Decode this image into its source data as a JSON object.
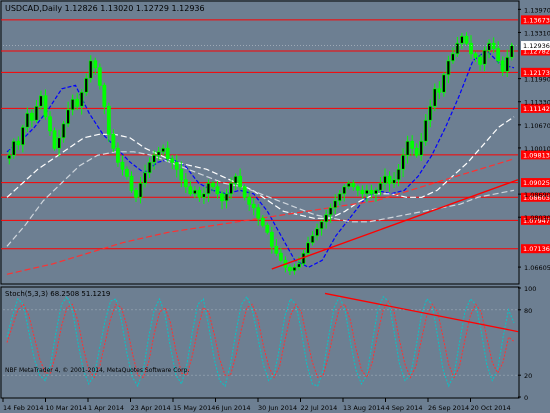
{
  "colors": {
    "background": "#6d7f92",
    "panel_border": "#000000",
    "axis_text": "#000000",
    "candle": "#00ff00",
    "resistance": "#ff0000",
    "ma_fast": "#0000ff",
    "ma_mid": "#ffffff",
    "ma_slow_dash": "#ff3030",
    "ma_gray_dash": "#cfd6dd",
    "stoch_main": "#00c8c8",
    "stoch_signal": "#ff3030",
    "price_label_bg": "#ff0000",
    "price_label_text": "#ffffff",
    "current_label_bg": "#ffffff",
    "current_label_text": "#000000"
  },
  "chart_data": [
    {
      "type": "candlestick",
      "header": "USDCAD,Daily  1.12826 1.13020 1.12729 1.12936",
      "symbol": "USDCAD",
      "timeframe": "Daily",
      "ohlc_current": {
        "open": 1.12826,
        "high": 1.1302,
        "low": 1.12729,
        "close": 1.12936
      },
      "y_ticks": [
        "1.13970",
        "1.13310",
        "1.11990",
        "1.11330",
        "1.10670",
        "1.10010",
        "1.08690",
        "1.08030",
        "1.06605"
      ],
      "ylim": [
        1.0615,
        1.1418
      ],
      "x_ticks": [
        "14 Feb 2014",
        "10 Mar 2014",
        "1 Apr 2014",
        "23 Apr 2014",
        "15 May 2014",
        "6 Jun 2014",
        "30 Jun 2014",
        "22 Jul 2014",
        "13 Aug 2014",
        "4 Sep 2014",
        "26 Sep 2014",
        "20 Oct 2014"
      ],
      "horizontal_lines": [
        {
          "price": 1.1367,
          "label": "1.13673"
        },
        {
          "price": 1.1278,
          "label": "1.12782"
        },
        {
          "price": 1.1217,
          "label": "1.12173"
        },
        {
          "price": 1.1114,
          "label": "1.11142"
        },
        {
          "price": 1.0981,
          "label": "1.09813"
        },
        {
          "price": 1.0902,
          "label": "1.09025"
        },
        {
          "price": 1.086,
          "label": "1.08603"
        },
        {
          "price": 1.0794,
          "label": "1.07947"
        },
        {
          "price": 1.0713,
          "label": "1.07136"
        }
      ],
      "current_price_label": "1.12936",
      "current_price": 1.12936,
      "close_series": [
        1.098,
        1.102,
        1.101,
        1.106,
        1.11,
        1.108,
        1.112,
        1.115,
        1.109,
        1.105,
        1.1,
        1.103,
        1.107,
        1.111,
        1.114,
        1.112,
        1.116,
        1.12,
        1.125,
        1.123,
        1.118,
        1.112,
        1.104,
        1.1,
        1.096,
        1.094,
        1.092,
        1.088,
        1.086,
        1.09,
        1.093,
        1.096,
        1.098,
        1.099,
        1.1,
        1.097,
        1.096,
        1.094,
        1.091,
        1.089,
        1.087,
        1.088,
        1.086,
        1.087,
        1.09,
        1.089,
        1.087,
        1.085,
        1.087,
        1.09,
        1.092,
        1.089,
        1.086,
        1.084,
        1.083,
        1.08,
        1.078,
        1.076,
        1.072,
        1.07,
        1.068,
        1.066,
        1.065,
        1.066,
        1.067,
        1.07,
        1.073,
        1.075,
        1.077,
        1.079,
        1.081,
        1.083,
        1.085,
        1.087,
        1.089,
        1.09,
        1.089,
        1.088,
        1.087,
        1.088,
        1.087,
        1.088,
        1.09,
        1.092,
        1.09,
        1.091,
        1.094,
        1.098,
        1.102,
        1.1,
        1.098,
        1.102,
        1.108,
        1.112,
        1.117,
        1.116,
        1.121,
        1.125,
        1.127,
        1.13,
        1.132,
        1.13,
        1.127,
        1.126,
        1.124,
        1.128,
        1.13,
        1.1285,
        1.125,
        1.122,
        1.126,
        1.12936
      ],
      "overlays": [
        {
          "name": "ma-fast",
          "style": "dashed",
          "color_key": "ma_fast",
          "values": [
            1.099,
            1.102,
            1.106,
            1.111,
            1.117,
            1.118,
            1.11,
            1.104,
            1.1,
            1.096,
            1.093,
            1.096,
            1.097,
            1.095,
            1.09,
            1.088,
            1.087,
            1.088,
            1.087,
            1.082,
            1.075,
            1.068,
            1.066,
            1.068,
            1.075,
            1.08,
            1.085,
            1.088,
            1.087,
            1.088,
            1.092,
            1.098,
            1.106,
            1.115,
            1.125,
            1.128,
            1.124,
            1.123
          ]
        },
        {
          "name": "ma-mid",
          "style": "dashed",
          "color_key": "ma_mid",
          "values": [
            1.086,
            1.09,
            1.094,
            1.097,
            1.1,
            1.103,
            1.104,
            1.104,
            1.103,
            1.1,
            1.098,
            1.096,
            1.095,
            1.094,
            1.092,
            1.09,
            1.088,
            1.085,
            1.082,
            1.081,
            1.08,
            1.08,
            1.082,
            1.085,
            1.087,
            1.087,
            1.086,
            1.086,
            1.088,
            1.092,
            1.096,
            1.101,
            1.106,
            1.109
          ]
        },
        {
          "name": "ma-gray",
          "style": "dashed",
          "color_key": "ma_gray_dash",
          "values": [
            1.072,
            1.078,
            1.085,
            1.09,
            1.095,
            1.098,
            1.099,
            1.099,
            1.098,
            1.096,
            1.094,
            1.092,
            1.09,
            1.089,
            1.087,
            1.085,
            1.083,
            1.081,
            1.08,
            1.079,
            1.079,
            1.08,
            1.081,
            1.082,
            1.083,
            1.084,
            1.086,
            1.087,
            1.088
          ]
        },
        {
          "name": "ma-slow",
          "style": "dashed",
          "color_key": "ma_slow_dash",
          "values": [
            1.064,
            1.0655,
            1.067,
            1.069,
            1.071,
            1.073,
            1.0745,
            1.076,
            1.077,
            1.078,
            1.079,
            1.08,
            1.081,
            1.082,
            1.083,
            1.084,
            1.085,
            1.087,
            1.089,
            1.091,
            1.093,
            1.095,
            1.097
          ]
        }
      ],
      "trendlines": [
        {
          "name": "support-trendline",
          "from_index": 58,
          "from_price": 1.0655,
          "to_index": 113,
          "to_price": 1.091,
          "color_key": "resistance"
        }
      ]
    },
    {
      "type": "line",
      "header": "Stoch(5,3,3) 68.2508 51.1219",
      "indicator": "Stochastic Oscillator",
      "params": "5,3,3",
      "main_value": 68.2508,
      "signal_value": 51.1219,
      "y_ticks": [
        "100",
        "80",
        "20",
        "0"
      ],
      "ylim": [
        0,
        100
      ],
      "levels": [
        80,
        20
      ],
      "series": [
        {
          "name": "main",
          "color_key": "stoch_main",
          "values": [
            55,
            75,
            90,
            85,
            60,
            35,
            20,
            15,
            30,
            60,
            85,
            92,
            80,
            50,
            25,
            12,
            20,
            45,
            70,
            88,
            90,
            70,
            40,
            18,
            10,
            25,
            55,
            80,
            90,
            75,
            45,
            20,
            12,
            30,
            60,
            85,
            90,
            65,
            35,
            15,
            10,
            30,
            60,
            85,
            92,
            80,
            55,
            30,
            15,
            20,
            45,
            75,
            90,
            85,
            60,
            30,
            12,
            10,
            25,
            55,
            82,
            92,
            80,
            50,
            25,
            12,
            20,
            50,
            80,
            92,
            88,
            60,
            30,
            15,
            20,
            45,
            75,
            90,
            85,
            55,
            25,
            10,
            20,
            50,
            78,
            90,
            85,
            60,
            30,
            15,
            25,
            55,
            80,
            68
          ]
        },
        {
          "name": "signal",
          "color_key": "stoch_signal",
          "values": [
            50,
            65,
            80,
            85,
            75,
            55,
            35,
            22,
            22,
            40,
            65,
            82,
            85,
            70,
            45,
            25,
            18,
            28,
            50,
            72,
            85,
            82,
            65,
            40,
            20,
            18,
            32,
            58,
            78,
            82,
            68,
            42,
            22,
            20,
            38,
            62,
            82,
            78,
            58,
            35,
            20,
            20,
            38,
            62,
            82,
            85,
            72,
            48,
            28,
            18,
            28,
            52,
            75,
            85,
            78,
            55,
            32,
            18,
            20,
            38,
            62,
            82,
            85,
            70,
            45,
            25,
            18,
            32,
            58,
            80,
            88,
            78,
            52,
            30,
            18,
            28,
            52,
            75,
            85,
            78,
            55,
            30,
            18,
            28,
            52,
            75,
            85,
            78,
            55,
            32,
            22,
            32,
            55,
            51
          ]
        }
      ],
      "trendlines": [
        {
          "name": "stoch-trendline",
          "from_index": 73,
          "from_value": 95,
          "to_index": 113,
          "to_value": 60,
          "color_key": "resistance"
        }
      ]
    }
  ],
  "footer": "NBF MetaTrader 4, © 2001-2014, MetaQuotes Software Corp."
}
